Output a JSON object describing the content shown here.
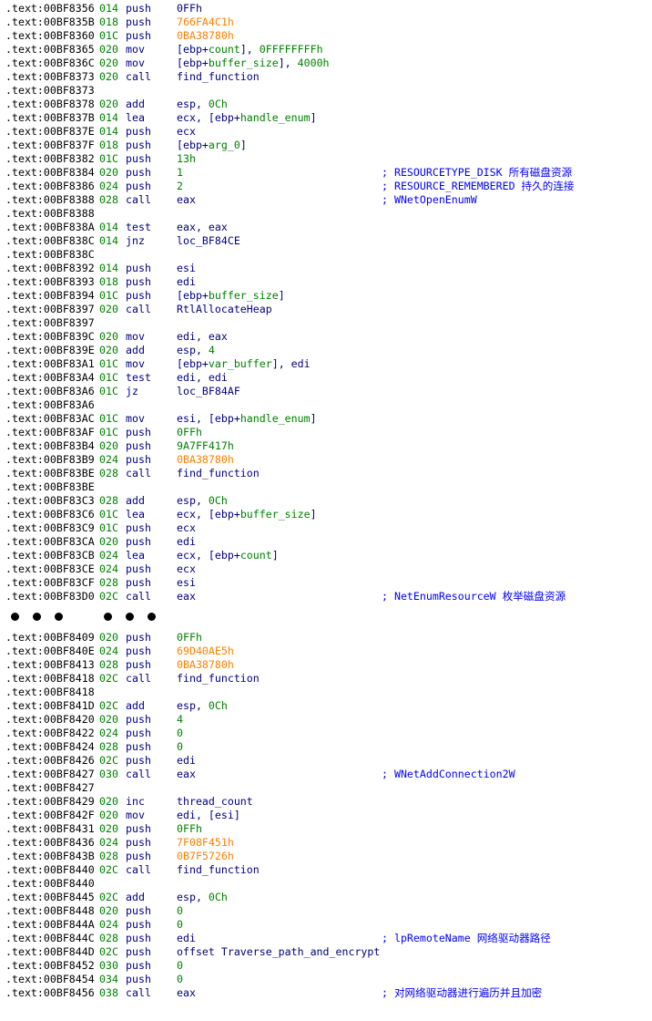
{
  "listing": {
    "block1": [
      {
        "addr": ".text:00BF8356",
        "sp": "014",
        "mn": "push",
        "op": [
          {
            "t": "0FFh",
            "c": "num"
          }
        ],
        "cmt": ""
      },
      {
        "addr": ".text:00BF835B",
        "sp": "018",
        "mn": "push",
        "op": [
          {
            "t": "766FA4C1h",
            "c": "hex"
          }
        ],
        "cmt": ""
      },
      {
        "addr": ".text:00BF8360",
        "sp": "01C",
        "mn": "push",
        "op": [
          {
            "t": "0BA38780h",
            "c": "hex"
          }
        ],
        "cmt": ""
      },
      {
        "addr": ".text:00BF8365",
        "sp": "020",
        "mn": "mov",
        "op": [
          {
            "t": "[ebp+",
            "c": "reg"
          },
          {
            "t": "count",
            "c": "var"
          },
          {
            "t": "], ",
            "c": "reg"
          },
          {
            "t": "0FFFFFFFFh",
            "c": "var"
          }
        ],
        "cmt": ""
      },
      {
        "addr": ".text:00BF836C",
        "sp": "020",
        "mn": "mov",
        "op": [
          {
            "t": "[ebp+",
            "c": "reg"
          },
          {
            "t": "buffer_size",
            "c": "var"
          },
          {
            "t": "], ",
            "c": "reg"
          },
          {
            "t": "4000h",
            "c": "var"
          }
        ],
        "cmt": ""
      },
      {
        "addr": ".text:00BF8373",
        "sp": "020",
        "mn": "call",
        "op": [
          {
            "t": "find_function",
            "c": "reg"
          }
        ],
        "cmt": ""
      },
      {
        "addr": ".text:00BF8373",
        "sp": "",
        "mn": "",
        "op": [],
        "cmt": ""
      },
      {
        "addr": ".text:00BF8378",
        "sp": "020",
        "mn": "add",
        "op": [
          {
            "t": "esp, ",
            "c": "reg"
          },
          {
            "t": "0Ch",
            "c": "var"
          }
        ],
        "cmt": ""
      },
      {
        "addr": ".text:00BF837B",
        "sp": "014",
        "mn": "lea",
        "op": [
          {
            "t": "ecx, [ebp+",
            "c": "reg"
          },
          {
            "t": "handle_enum",
            "c": "var"
          },
          {
            "t": "]",
            "c": "reg"
          }
        ],
        "cmt": ""
      },
      {
        "addr": ".text:00BF837E",
        "sp": "014",
        "mn": "push",
        "op": [
          {
            "t": "ecx",
            "c": "reg"
          }
        ],
        "cmt": ""
      },
      {
        "addr": ".text:00BF837F",
        "sp": "018",
        "mn": "push",
        "op": [
          {
            "t": "[ebp+",
            "c": "reg"
          },
          {
            "t": "arg_0",
            "c": "var"
          },
          {
            "t": "]",
            "c": "reg"
          }
        ],
        "cmt": ""
      },
      {
        "addr": ".text:00BF8382",
        "sp": "01C",
        "mn": "push",
        "op": [
          {
            "t": "13h",
            "c": "var"
          }
        ],
        "cmt": ""
      },
      {
        "addr": ".text:00BF8384",
        "sp": "020",
        "mn": "push",
        "op": [
          {
            "t": "1",
            "c": "var"
          }
        ],
        "cmt": "; RESOURCETYPE_DISK 所有磁盘资源"
      },
      {
        "addr": ".text:00BF8386",
        "sp": "024",
        "mn": "push",
        "op": [
          {
            "t": "2",
            "c": "var"
          }
        ],
        "cmt": "; RESOURCE_REMEMBERED 持久的连接"
      },
      {
        "addr": ".text:00BF8388",
        "sp": "028",
        "mn": "call",
        "op": [
          {
            "t": "eax",
            "c": "reg"
          }
        ],
        "cmt": "; WNetOpenEnumW"
      },
      {
        "addr": ".text:00BF8388",
        "sp": "",
        "mn": "",
        "op": [],
        "cmt": ""
      },
      {
        "addr": ".text:00BF838A",
        "sp": "014",
        "mn": "test",
        "op": [
          {
            "t": "eax, eax",
            "c": "reg"
          }
        ],
        "cmt": ""
      },
      {
        "addr": ".text:00BF838C",
        "sp": "014",
        "mn": "jnz",
        "op": [
          {
            "t": "loc_BF84CE",
            "c": "reg"
          }
        ],
        "cmt": ""
      },
      {
        "addr": ".text:00BF838C",
        "sp": "",
        "mn": "",
        "op": [],
        "cmt": ""
      },
      {
        "addr": ".text:00BF8392",
        "sp": "014",
        "mn": "push",
        "op": [
          {
            "t": "esi",
            "c": "reg"
          }
        ],
        "cmt": ""
      },
      {
        "addr": ".text:00BF8393",
        "sp": "018",
        "mn": "push",
        "op": [
          {
            "t": "edi",
            "c": "reg"
          }
        ],
        "cmt": ""
      },
      {
        "addr": ".text:00BF8394",
        "sp": "01C",
        "mn": "push",
        "op": [
          {
            "t": "[ebp+",
            "c": "reg"
          },
          {
            "t": "buffer_size",
            "c": "var"
          },
          {
            "t": "]",
            "c": "reg"
          }
        ],
        "cmt": ""
      },
      {
        "addr": ".text:00BF8397",
        "sp": "020",
        "mn": "call",
        "op": [
          {
            "t": "RtlAllocateHeap",
            "c": "reg"
          }
        ],
        "cmt": ""
      },
      {
        "addr": ".text:00BF8397",
        "sp": "",
        "mn": "",
        "op": [],
        "cmt": ""
      },
      {
        "addr": ".text:00BF839C",
        "sp": "020",
        "mn": "mov",
        "op": [
          {
            "t": "edi, eax",
            "c": "reg"
          }
        ],
        "cmt": ""
      },
      {
        "addr": ".text:00BF839E",
        "sp": "020",
        "mn": "add",
        "op": [
          {
            "t": "esp, ",
            "c": "reg"
          },
          {
            "t": "4",
            "c": "var"
          }
        ],
        "cmt": ""
      },
      {
        "addr": ".text:00BF83A1",
        "sp": "01C",
        "mn": "mov",
        "op": [
          {
            "t": "[ebp+",
            "c": "reg"
          },
          {
            "t": "var_buffer",
            "c": "var"
          },
          {
            "t": "], edi",
            "c": "reg"
          }
        ],
        "cmt": ""
      },
      {
        "addr": ".text:00BF83A4",
        "sp": "01C",
        "mn": "test",
        "op": [
          {
            "t": "edi, edi",
            "c": "reg"
          }
        ],
        "cmt": ""
      },
      {
        "addr": ".text:00BF83A6",
        "sp": "01C",
        "mn": "jz",
        "op": [
          {
            "t": "loc_BF84AF",
            "c": "reg"
          }
        ],
        "cmt": ""
      },
      {
        "addr": ".text:00BF83A6",
        "sp": "",
        "mn": "",
        "op": [],
        "cmt": ""
      },
      {
        "addr": ".text:00BF83AC",
        "sp": "01C",
        "mn": "mov",
        "op": [
          {
            "t": "esi, [ebp+",
            "c": "reg"
          },
          {
            "t": "handle_enum",
            "c": "var"
          },
          {
            "t": "]",
            "c": "reg"
          }
        ],
        "cmt": ""
      },
      {
        "addr": ".text:00BF83AF",
        "sp": "01C",
        "mn": "push",
        "op": [
          {
            "t": "0FFh",
            "c": "var"
          }
        ],
        "cmt": ""
      },
      {
        "addr": ".text:00BF83B4",
        "sp": "020",
        "mn": "push",
        "op": [
          {
            "t": "9A7FF417h",
            "c": "var"
          }
        ],
        "cmt": ""
      },
      {
        "addr": ".text:00BF83B9",
        "sp": "024",
        "mn": "push",
        "op": [
          {
            "t": "0BA38780h",
            "c": "hex"
          }
        ],
        "cmt": ""
      },
      {
        "addr": ".text:00BF83BE",
        "sp": "028",
        "mn": "call",
        "op": [
          {
            "t": "find_function",
            "c": "reg"
          }
        ],
        "cmt": ""
      },
      {
        "addr": ".text:00BF83BE",
        "sp": "",
        "mn": "",
        "op": [],
        "cmt": ""
      },
      {
        "addr": ".text:00BF83C3",
        "sp": "028",
        "mn": "add",
        "op": [
          {
            "t": "esp, ",
            "c": "reg"
          },
          {
            "t": "0Ch",
            "c": "var"
          }
        ],
        "cmt": ""
      },
      {
        "addr": ".text:00BF83C6",
        "sp": "01C",
        "mn": "lea",
        "op": [
          {
            "t": "ecx, [ebp+",
            "c": "reg"
          },
          {
            "t": "buffer_size",
            "c": "var"
          },
          {
            "t": "]",
            "c": "reg"
          }
        ],
        "cmt": ""
      },
      {
        "addr": ".text:00BF83C9",
        "sp": "01C",
        "mn": "push",
        "op": [
          {
            "t": "ecx",
            "c": "reg"
          }
        ],
        "cmt": ""
      },
      {
        "addr": ".text:00BF83CA",
        "sp": "020",
        "mn": "push",
        "op": [
          {
            "t": "edi",
            "c": "reg"
          }
        ],
        "cmt": ""
      },
      {
        "addr": ".text:00BF83CB",
        "sp": "024",
        "mn": "lea",
        "op": [
          {
            "t": "ecx, [ebp+",
            "c": "reg"
          },
          {
            "t": "count",
            "c": "var"
          },
          {
            "t": "]",
            "c": "reg"
          }
        ],
        "cmt": ""
      },
      {
        "addr": ".text:00BF83CE",
        "sp": "024",
        "mn": "push",
        "op": [
          {
            "t": "ecx",
            "c": "reg"
          }
        ],
        "cmt": ""
      },
      {
        "addr": ".text:00BF83CF",
        "sp": "028",
        "mn": "push",
        "op": [
          {
            "t": "esi",
            "c": "reg"
          }
        ],
        "cmt": ""
      },
      {
        "addr": ".text:00BF83D0",
        "sp": "02C",
        "mn": "call",
        "op": [
          {
            "t": "eax",
            "c": "reg"
          }
        ],
        "cmt": "; NetEnumResourceW 枚举磁盘资源"
      }
    ],
    "block2": [
      {
        "addr": ".text:00BF8409",
        "sp": "020",
        "mn": "push",
        "op": [
          {
            "t": "0FFh",
            "c": "var"
          }
        ],
        "cmt": ""
      },
      {
        "addr": ".text:00BF840E",
        "sp": "024",
        "mn": "push",
        "op": [
          {
            "t": "69D40AE5h",
            "c": "hex"
          }
        ],
        "cmt": ""
      },
      {
        "addr": ".text:00BF8413",
        "sp": "028",
        "mn": "push",
        "op": [
          {
            "t": "0BA38780h",
            "c": "hex"
          }
        ],
        "cmt": ""
      },
      {
        "addr": ".text:00BF8418",
        "sp": "02C",
        "mn": "call",
        "op": [
          {
            "t": "find_function",
            "c": "reg"
          }
        ],
        "cmt": ""
      },
      {
        "addr": ".text:00BF8418",
        "sp": "",
        "mn": "",
        "op": [],
        "cmt": ""
      },
      {
        "addr": ".text:00BF841D",
        "sp": "02C",
        "mn": "add",
        "op": [
          {
            "t": "esp, ",
            "c": "reg"
          },
          {
            "t": "0Ch",
            "c": "var"
          }
        ],
        "cmt": ""
      },
      {
        "addr": ".text:00BF8420",
        "sp": "020",
        "mn": "push",
        "op": [
          {
            "t": "4",
            "c": "var"
          }
        ],
        "cmt": ""
      },
      {
        "addr": ".text:00BF8422",
        "sp": "024",
        "mn": "push",
        "op": [
          {
            "t": "0",
            "c": "var"
          }
        ],
        "cmt": ""
      },
      {
        "addr": ".text:00BF8424",
        "sp": "028",
        "mn": "push",
        "op": [
          {
            "t": "0",
            "c": "var"
          }
        ],
        "cmt": ""
      },
      {
        "addr": ".text:00BF8426",
        "sp": "02C",
        "mn": "push",
        "op": [
          {
            "t": "edi",
            "c": "reg"
          }
        ],
        "cmt": ""
      },
      {
        "addr": ".text:00BF8427",
        "sp": "030",
        "mn": "call",
        "op": [
          {
            "t": "eax",
            "c": "reg"
          }
        ],
        "cmt": "; WNetAddConnection2W"
      },
      {
        "addr": ".text:00BF8427",
        "sp": "",
        "mn": "",
        "op": [],
        "cmt": ""
      },
      {
        "addr": ".text:00BF8429",
        "sp": "020",
        "mn": "inc",
        "op": [
          {
            "t": "thread_count",
            "c": "reg"
          }
        ],
        "cmt": ""
      },
      {
        "addr": ".text:00BF842F",
        "sp": "020",
        "mn": "mov",
        "op": [
          {
            "t": "edi, [esi]",
            "c": "reg"
          }
        ],
        "cmt": ""
      },
      {
        "addr": ".text:00BF8431",
        "sp": "020",
        "mn": "push",
        "op": [
          {
            "t": "0FFh",
            "c": "var"
          }
        ],
        "cmt": ""
      },
      {
        "addr": ".text:00BF8436",
        "sp": "024",
        "mn": "push",
        "op": [
          {
            "t": "7F08F451h",
            "c": "hex"
          }
        ],
        "cmt": ""
      },
      {
        "addr": ".text:00BF843B",
        "sp": "028",
        "mn": "push",
        "op": [
          {
            "t": "0B7F5726h",
            "c": "hex"
          }
        ],
        "cmt": ""
      },
      {
        "addr": ".text:00BF8440",
        "sp": "02C",
        "mn": "call",
        "op": [
          {
            "t": "find_function",
            "c": "reg"
          }
        ],
        "cmt": ""
      },
      {
        "addr": ".text:00BF8440",
        "sp": "",
        "mn": "",
        "op": [],
        "cmt": ""
      },
      {
        "addr": ".text:00BF8445",
        "sp": "02C",
        "mn": "add",
        "op": [
          {
            "t": "esp, ",
            "c": "reg"
          },
          {
            "t": "0Ch",
            "c": "var"
          }
        ],
        "cmt": ""
      },
      {
        "addr": ".text:00BF8448",
        "sp": "020",
        "mn": "push",
        "op": [
          {
            "t": "0",
            "c": "var"
          }
        ],
        "cmt": ""
      },
      {
        "addr": ".text:00BF844A",
        "sp": "024",
        "mn": "push",
        "op": [
          {
            "t": "0",
            "c": "var"
          }
        ],
        "cmt": ""
      },
      {
        "addr": ".text:00BF844C",
        "sp": "028",
        "mn": "push",
        "op": [
          {
            "t": "edi",
            "c": "reg"
          }
        ],
        "cmt": "; lpRemoteName 网络驱动器路径"
      },
      {
        "addr": ".text:00BF844D",
        "sp": "02C",
        "mn": "push",
        "op": [
          {
            "t": "offset Traverse_path_and_encrypt",
            "c": "reg"
          }
        ],
        "cmt": ""
      },
      {
        "addr": ".text:00BF8452",
        "sp": "030",
        "mn": "push",
        "op": [
          {
            "t": "0",
            "c": "var"
          }
        ],
        "cmt": ""
      },
      {
        "addr": ".text:00BF8454",
        "sp": "034",
        "mn": "push",
        "op": [
          {
            "t": "0",
            "c": "var"
          }
        ],
        "cmt": ""
      },
      {
        "addr": ".text:00BF8456",
        "sp": "038",
        "mn": "call",
        "op": [
          {
            "t": "eax",
            "c": "reg"
          }
        ],
        "cmt": "; 对网络驱动器进行遍历并且加密"
      }
    ]
  },
  "colors": {
    "address": "#000000",
    "stack": "#008000",
    "mnemonic": "#000080",
    "number": "#008000",
    "hex_const": "#ff8000",
    "comment": "#0000ff"
  }
}
